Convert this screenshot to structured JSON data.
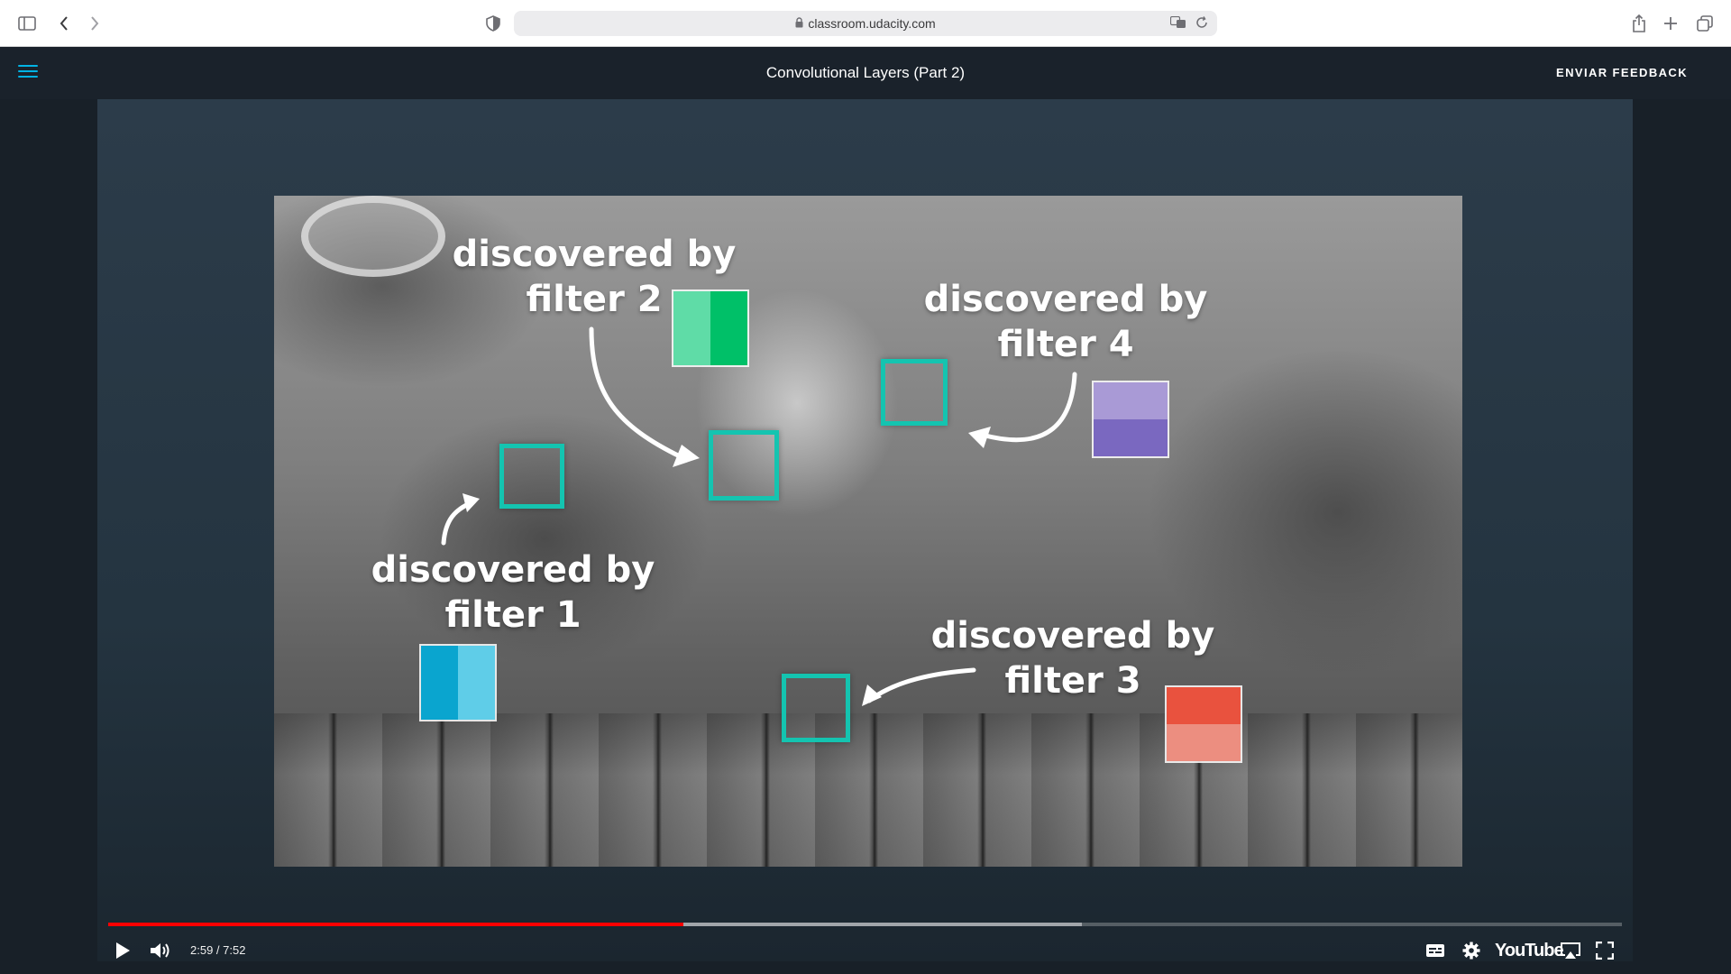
{
  "browser": {
    "url": "classroom.udacity.com",
    "icons": [
      "sidebar-icon",
      "back-icon",
      "forward-icon",
      "shield-icon",
      "lock-icon",
      "translate-icon",
      "reload-icon",
      "share-icon",
      "new-tab-icon",
      "tabs-icon"
    ]
  },
  "header": {
    "title": "Convolutional Layers (Part 2)",
    "feedback_label": "ENVIAR FEEDBACK",
    "accent": "#02b3e4"
  },
  "video": {
    "labels": {
      "filter1": [
        "discovered by",
        "filter 1"
      ],
      "filter2": [
        "discovered by",
        "filter 2"
      ],
      "filter3": [
        "discovered by",
        "filter 3"
      ],
      "filter4": [
        "discovered by",
        "filter 4"
      ]
    },
    "colors": {
      "target": "#14c4b0",
      "filter1_dark": "#0aa5cf",
      "filter1_light": "#5fcde8",
      "filter2_light": "#5fdca7",
      "filter2_dark": "#00c068",
      "filter3_dark": "#e9523e",
      "filter3_light": "#ec8e80",
      "filter4_light": "#a99ad6",
      "filter4_dark": "#7a68c0"
    }
  },
  "controls": {
    "time": "2:59 / 7:52",
    "played_fraction": 0.38,
    "buffered_fraction": 0.643,
    "logo": "YouTube",
    "progress_color": "#ff0000",
    "icons": [
      "play-icon",
      "volume-icon",
      "captions-icon",
      "settings-icon",
      "airplay-icon",
      "fullscreen-icon"
    ]
  }
}
